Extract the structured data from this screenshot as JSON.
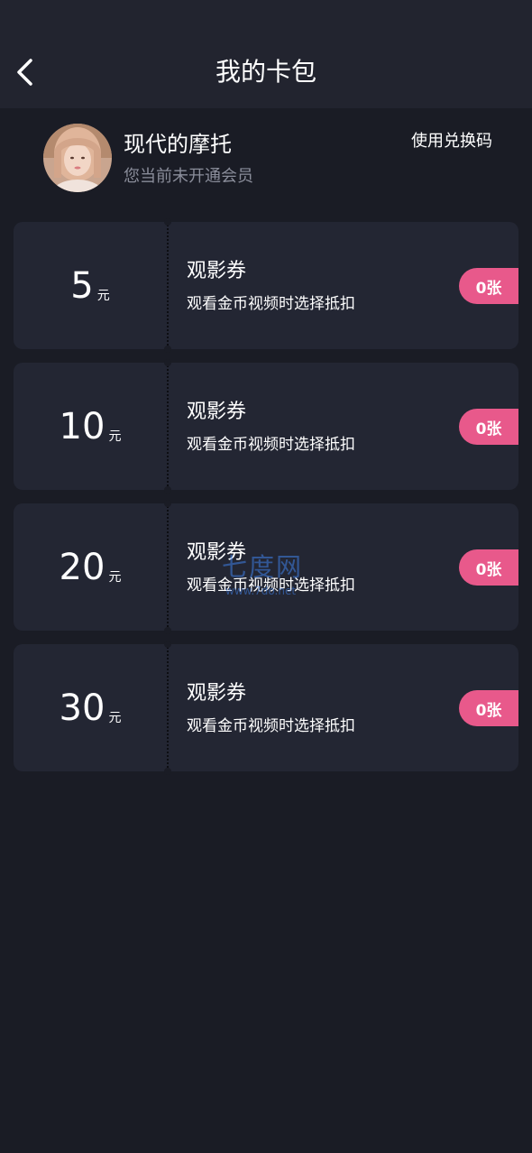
{
  "header": {
    "title": "我的卡包",
    "back_icon": "chevron-left-icon"
  },
  "profile": {
    "name": "现代的摩托",
    "member_status": "您当前未开通会员",
    "redeem_label": "使用兑换码"
  },
  "cards": [
    {
      "amount": "5",
      "unit": "元",
      "title": "观影券",
      "description": "观看金币视频时选择抵扣",
      "count": "0张"
    },
    {
      "amount": "10",
      "unit": "元",
      "title": "观影券",
      "description": "观看金币视频时选择抵扣",
      "count": "0张"
    },
    {
      "amount": "20",
      "unit": "元",
      "title": "观影券",
      "description": "观看金币视频时选择抵扣",
      "count": "0张"
    },
    {
      "amount": "30",
      "unit": "元",
      "title": "观影券",
      "description": "观看金币视频时选择抵扣",
      "count": "0张"
    }
  ],
  "watermark": {
    "text": "七度网",
    "sub": "www.7do.net"
  },
  "colors": {
    "background": "#1a1c25",
    "header": "#22242f",
    "card": "#232633",
    "badge": "#e8598b",
    "muted_text": "#8a8d9a"
  }
}
